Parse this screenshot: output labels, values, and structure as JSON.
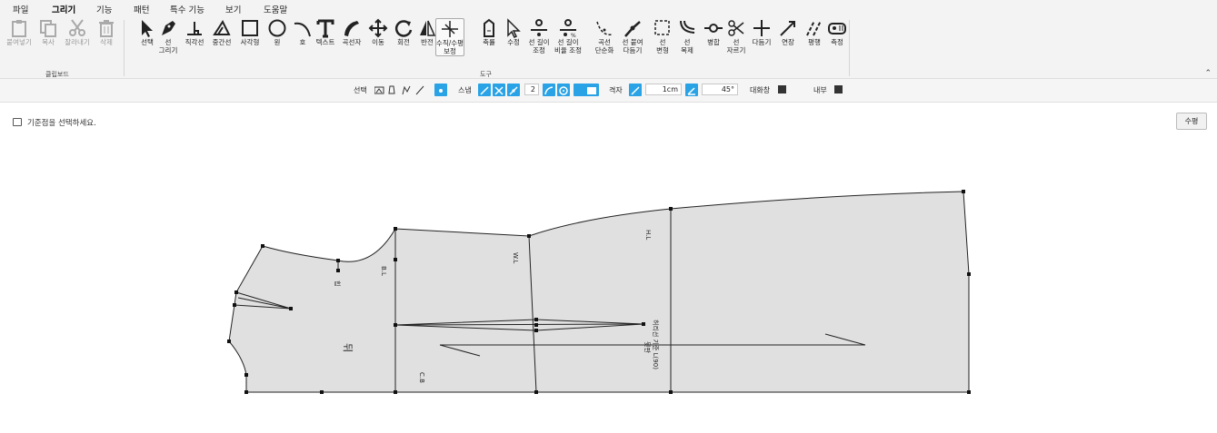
{
  "menu": [
    "파일",
    "그리기",
    "기능",
    "패턴",
    "특수 기능",
    "보기",
    "도움말"
  ],
  "ribbon": {
    "clipboard": {
      "group_label": "클립보드",
      "items": [
        {
          "label": "붙여넣기",
          "icon": "paste-icon"
        },
        {
          "label": "복사",
          "icon": "copy-icon"
        },
        {
          "label": "잘라내기",
          "icon": "cut-icon"
        },
        {
          "label": "삭제",
          "icon": "trash-icon"
        }
      ]
    },
    "tools": {
      "group_label": "도구",
      "items": [
        {
          "label": "선택",
          "icon": "select-arrow-icon"
        },
        {
          "label": "선\n그리기",
          "icon": "pen-icon"
        },
        {
          "label": "직각선",
          "icon": "right-angle-icon"
        },
        {
          "label": "중간선",
          "icon": "midline-icon"
        },
        {
          "label": "사각형",
          "icon": "rectangle-icon"
        },
        {
          "label": "원",
          "icon": "circle-icon"
        },
        {
          "label": "호",
          "icon": "arc-icon"
        },
        {
          "label": "텍스트",
          "icon": "text-icon"
        },
        {
          "label": "곡선자",
          "icon": "curve-ruler-icon"
        },
        {
          "label": "이동",
          "icon": "move-icon"
        },
        {
          "label": "회전",
          "icon": "rotate-icon"
        },
        {
          "label": "반전",
          "icon": "mirror-icon"
        },
        {
          "label": "수직/수평\n보정",
          "icon": "orthogonal-correct-icon"
        },
        {
          "label": "축률",
          "icon": "scale-icon"
        },
        {
          "label": "수정",
          "icon": "edit-arrow-icon"
        },
        {
          "label": "선 길이\n조정",
          "icon": "line-length-icon"
        },
        {
          "label": "선 길이\n비율 조정",
          "icon": "line-ratio-icon"
        },
        {
          "label": "곡선\n단순화",
          "icon": "simplify-curve-icon"
        },
        {
          "label": "선 붙여\n다듬기",
          "icon": "join-lines-icon"
        },
        {
          "label": "선\n변형",
          "icon": "transform-line-icon"
        },
        {
          "label": "선\n복제",
          "icon": "duplicate-line-icon"
        },
        {
          "label": "병합",
          "icon": "merge-icon"
        },
        {
          "label": "선\n자르기",
          "icon": "cut-line-icon"
        },
        {
          "label": "다듬기",
          "icon": "trim-icon"
        },
        {
          "label": "연장",
          "icon": "extend-icon"
        },
        {
          "label": "평행",
          "icon": "parallel-icon"
        },
        {
          "label": "측정",
          "icon": "measure-tape-icon"
        }
      ]
    }
  },
  "options": {
    "select_label": "선택",
    "snap_label": "스냅",
    "snap_count": "2",
    "grid_label": "격자",
    "grid_size": "1cm",
    "angle": "45°",
    "dialog_label": "대화창",
    "inner_label": "내부"
  },
  "canvas": {
    "hint": "기준점을 선택하세요.",
    "edit_button": "수평",
    "labels": {
      "back": "뒤",
      "bl": "B.L",
      "wl": "W.L",
      "hl": "H.L",
      "cb": "C.B",
      "hip": "힙",
      "right_line1": "허리선 기준 L(90)",
      "right_line2": "뒷판"
    }
  },
  "colors": {
    "accent": "#29a3e6",
    "pattern_fill": "#e0e0e0",
    "menu_underline": "#1e88e5"
  }
}
